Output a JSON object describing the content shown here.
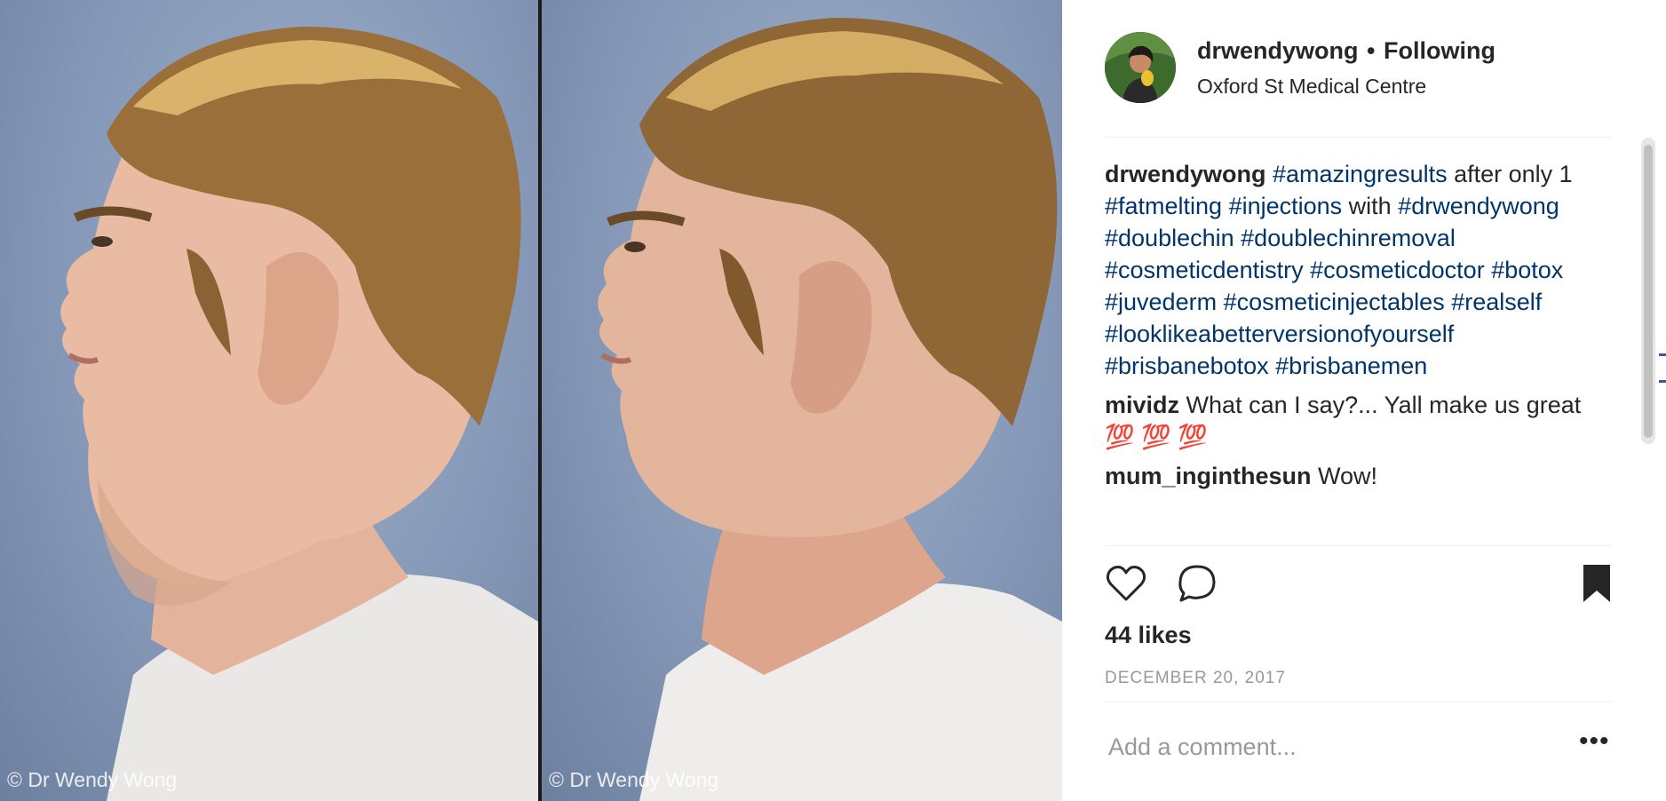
{
  "photos": [
    {
      "watermark": "© Dr Wendy Wong"
    },
    {
      "watermark": "© Dr Wendy Wong"
    }
  ],
  "header": {
    "username": "drwendywong",
    "separator": "•",
    "follow_status": "Following",
    "location": "Oxford St Medical Centre"
  },
  "caption": {
    "username": "drwendywong",
    "parts": [
      {
        "text": "#amazingresults",
        "tag": true
      },
      {
        "text": " after only 1 ",
        "tag": false
      },
      {
        "text": "#fatmelting",
        "tag": true
      },
      {
        "text": " ",
        "tag": false
      },
      {
        "text": "#injections",
        "tag": true
      },
      {
        "text": " with ",
        "tag": false
      },
      {
        "text": "#drwendywong",
        "tag": true
      },
      {
        "text": " ",
        "tag": false
      },
      {
        "text": "#doublechin",
        "tag": true
      },
      {
        "text": " ",
        "tag": false
      },
      {
        "text": "#doublechinremoval",
        "tag": true
      },
      {
        "text": " ",
        "tag": false
      },
      {
        "text": "#cosmeticdentistry",
        "tag": true
      },
      {
        "text": " ",
        "tag": false
      },
      {
        "text": "#cosmeticdoctor",
        "tag": true
      },
      {
        "text": " ",
        "tag": false
      },
      {
        "text": "#botox",
        "tag": true
      },
      {
        "text": " ",
        "tag": false
      },
      {
        "text": "#juvederm",
        "tag": true
      },
      {
        "text": " ",
        "tag": false
      },
      {
        "text": "#cosmeticinjectables",
        "tag": true
      },
      {
        "text": " ",
        "tag": false
      },
      {
        "text": "#realself",
        "tag": true
      },
      {
        "text": " ",
        "tag": false
      },
      {
        "text": "#looklikeabetterversionofyourself",
        "tag": true
      },
      {
        "text": " ",
        "tag": false
      },
      {
        "text": "#brisbanebotox",
        "tag": true
      },
      {
        "text": " ",
        "tag": false
      },
      {
        "text": "#brisbanemen",
        "tag": true
      }
    ]
  },
  "comments": [
    {
      "username": "mividz",
      "text": "What can I say?... Yall make us great 💯 💯 💯"
    },
    {
      "username": "mum_inginthesun",
      "text": "Wow!"
    }
  ],
  "actions": {
    "like_icon": "heart-outline-icon",
    "comment_icon": "comment-bubble-icon",
    "save_icon": "bookmark-filled-icon"
  },
  "likes": "44 likes",
  "date": "DECEMBER 20, 2017",
  "add_comment": {
    "placeholder": "Add a comment...",
    "more_label": "•••"
  },
  "colors": {
    "hashtag": "#003569",
    "text": "#262626",
    "muted": "#999999",
    "divider": "#efefef"
  }
}
